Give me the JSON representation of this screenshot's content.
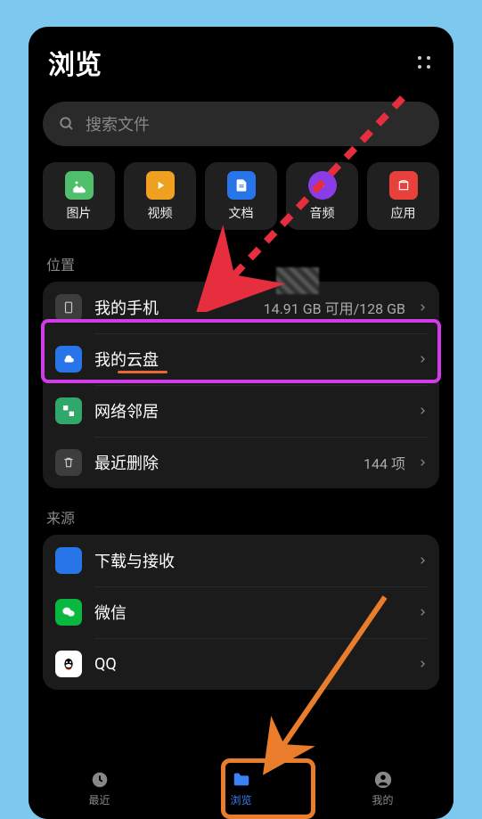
{
  "header": {
    "title": "浏览"
  },
  "search": {
    "placeholder": "搜索文件"
  },
  "categories": [
    {
      "label": "图片",
      "color": "#4fbf6b"
    },
    {
      "label": "视频",
      "color": "#f0a020"
    },
    {
      "label": "文档",
      "color": "#2775e8"
    },
    {
      "label": "音频",
      "color": "#8a3ce6"
    },
    {
      "label": "应用",
      "color": "#e8403a"
    }
  ],
  "section_location": {
    "label": "位置"
  },
  "location_items": [
    {
      "label": "我的手机",
      "sub": "14.91 GB 可用/128 GB",
      "icon_bg": "#3d3d3d"
    },
    {
      "label": "我的云盘",
      "sub": "",
      "icon_bg": "#2775e8"
    },
    {
      "label": "网络邻居",
      "sub": "",
      "icon_bg": "#2fa86a"
    },
    {
      "label": "最近删除",
      "sub": "144 项",
      "icon_bg": "#3d3d3d"
    }
  ],
  "section_source": {
    "label": "来源"
  },
  "source_items": [
    {
      "label": "下载与接收",
      "icon_bg": "#2775e8"
    },
    {
      "label": "微信",
      "icon_bg": "#09b83e"
    },
    {
      "label": "QQ",
      "icon_bg": "#ffffff"
    }
  ],
  "nav": [
    {
      "label": "最近"
    },
    {
      "label": "浏览"
    },
    {
      "label": "我的"
    }
  ]
}
